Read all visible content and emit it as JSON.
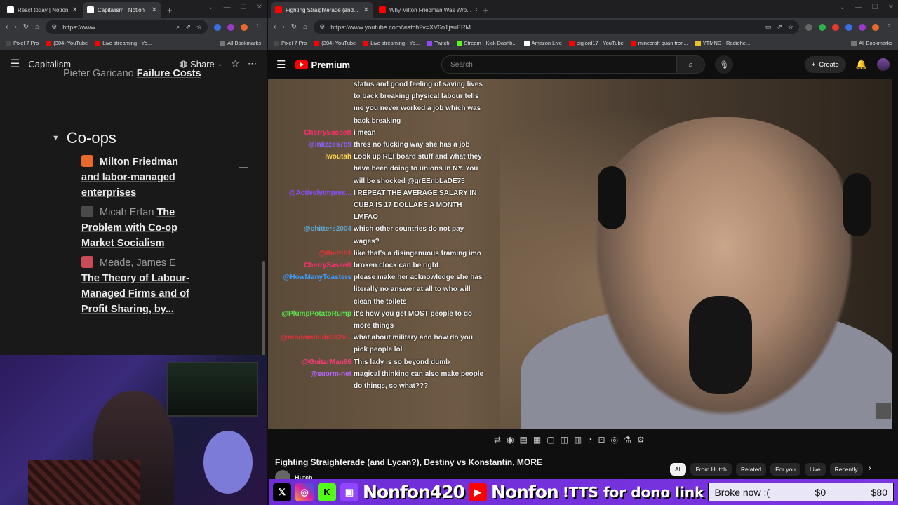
{
  "left_browser": {
    "tabs": [
      {
        "label": "React today | Notion"
      },
      {
        "label": "Capitalism | Notion"
      }
    ],
    "url": "https://www...",
    "bookmarks": [
      "Pixel 7 Pro",
      "(304) YouTube",
      "Live streaming - Yo..."
    ],
    "all_bookmarks": "All Bookmarks"
  },
  "notion": {
    "title": "Capitalism",
    "share_label": "Share",
    "prev_item": {
      "author": "Pieter Garicano",
      "title": "Failure Costs"
    },
    "section_heading": "Co-ops",
    "items": [
      {
        "author": "",
        "title": "Milton Friedman and labor-managed enterprises",
        "icon_color": "#e8692c"
      },
      {
        "author": "Micah Erfan",
        "title": "The Problem with Co-op Market Socialism",
        "icon_color": "#4a4a4a"
      },
      {
        "author": "Meade, James E",
        "title": "The Theory of Labour-Managed Firms and of Profit Sharing, by...",
        "icon_color": "#c94b57"
      }
    ]
  },
  "right_browser": {
    "tabs": [
      {
        "label": "Fighting Straighterade (and..."
      },
      {
        "label": "Why Milton Friedman Was Wro..."
      }
    ],
    "url": "https://www.youtube.com/watch?v=XV6oTjsuERM",
    "bookmarks": [
      "Pixel 7 Pro",
      "(304) YouTube",
      "Live streaming - Yo...",
      "Twitch",
      "Stream - Kick Dashb...",
      "Amazon Live",
      "piglord17 - YouTube",
      "minecraft quan tron...",
      "YTMND - Radiohe..."
    ],
    "all_bookmarks": "All Bookmarks"
  },
  "youtube": {
    "logo": "Premium",
    "search_placeholder": "Search",
    "create_label": "Create",
    "video_title": "Fighting Straighterade (and Lycan?), Destiny vs Konstantin, MORE",
    "channel": "Hutch",
    "chips": [
      "All",
      "From Hutch",
      "Related",
      "For you",
      "Live",
      "Recently"
    ]
  },
  "chat": [
    {
      "user": "",
      "color": "#ffffff",
      "text": "status and good feeling of saving lives to back breaking physical labour tells me you never worked a job which was back breaking"
    },
    {
      "user": "CherrySassett",
      "color": "#ff2e6e",
      "text": "i mean"
    },
    {
      "user": "@inkzzes789",
      "color": "#8a63ff",
      "text": "thres no fucking way she has a job"
    },
    {
      "user": "iwoutah",
      "color": "#ffd84a",
      "text": "Look up REI board stuff and what they have been doing to unions in NY. You will be shocked @grEEnbLaDE75"
    },
    {
      "user": "@ActivelyImpres...",
      "color": "#8a4dff",
      "text": "I REPEAT THE AVERAGE SALARY IN CUBA IS 17 DOLLARS A MONTH LMFAO"
    },
    {
      "user": "@chitters2004",
      "color": "#5fa8d3",
      "text": "which other countries do not pay wages?"
    },
    {
      "user": "@thetrib1",
      "color": "#e5323b",
      "text": "like that's a disingenuous framing imo"
    },
    {
      "user": "CherrySassett",
      "color": "#ff2e6e",
      "text": "broken clock can be right"
    },
    {
      "user": "@HowManyToasters",
      "color": "#3d9dff",
      "text": "please make her acknowledge she has literally no answer at all to who will clean the toilets"
    },
    {
      "user": "@PlumpPotatoRump",
      "color": "#5be34a",
      "text": "it's how you get MOST people to do more things"
    },
    {
      "user": "@randomdude3124...",
      "color": "#e5323b",
      "text": "what about military and how do you pick people lol"
    },
    {
      "user": "@GuitarMan96",
      "color": "#ff3a7a",
      "text": "This lady is so beyond dumb"
    },
    {
      "user": "@suorm-net",
      "color": "#b667ff",
      "text": "magical thinking can also make people do things, so what???"
    }
  ],
  "stream_overlay": {
    "handle1": "Nonfon420",
    "handle2": "Nonfon",
    "tts": "!TTS for dono link",
    "goal_label": "Broke now :(",
    "goal_current": "$0",
    "goal_target": "$80"
  }
}
